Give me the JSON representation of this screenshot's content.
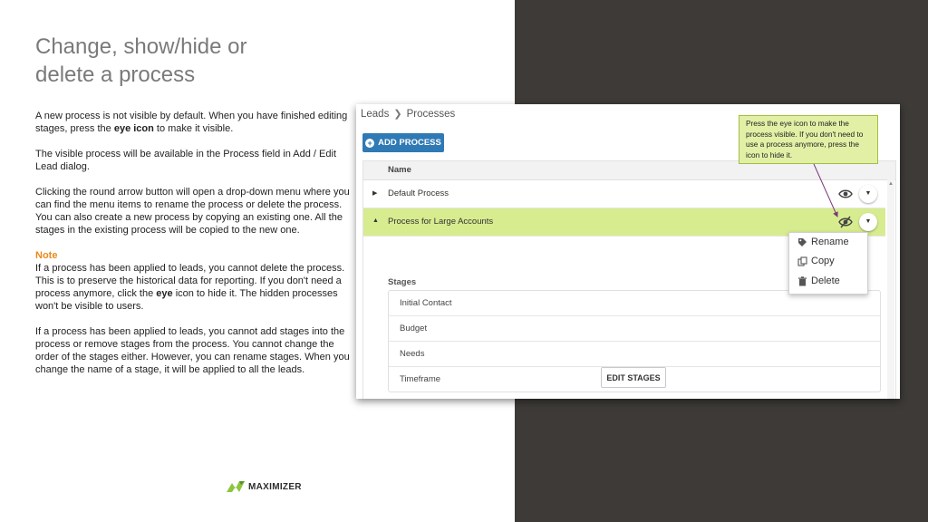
{
  "slide": {
    "title_line1": "Change, show/hide or",
    "title_line2": "delete a process",
    "paragraphs": {
      "p1_a": "A new process is not visible by default. When you have finished editing stages, press the ",
      "p1_b": "eye icon",
      "p1_c": " to make it visible.",
      "p2": "The visible process will be available in the Process field in Add / Edit Lead dialog.",
      "p3": "Clicking the round arrow button will open a drop-down menu where you can find the menu items to rename the process or delete the process. You can also create a new process by copying an existing one. All the stages in the existing process will be copied to the new one.",
      "note_title": "Note",
      "note_a": "If a process has been applied to leads, you cannot delete the process. This is to preserve the historical data for reporting. If you don't need a process anymore, click the ",
      "note_b": "eye",
      "note_c": " icon to hide it. The hidden processes won't be visible to users.",
      "p5": "If a process has been applied to leads, you cannot add stages into the process or remove stages from the process. You cannot change the order of the stages either. However, you can rename stages. When you change the name of a stage, it will be applied to all the leads."
    },
    "logo_text": "MAXIMIZER",
    "colors": {
      "dark_panel": "#3d3a37",
      "accent_orange": "#e98a1b",
      "brand_green": "#8cc63f",
      "selected_row": "#d7ec8f",
      "primary_button": "#2f7ab5"
    }
  },
  "app": {
    "breadcrumb": {
      "root": "Leads",
      "current": "Processes"
    },
    "add_process_label": "ADD PROCESS",
    "table_header": "Name",
    "processes": [
      {
        "name": "Default Process",
        "expanded": false,
        "eye_icon": "eye-icon"
      },
      {
        "name": "Process for Large Accounts",
        "expanded": true,
        "eye_icon": "eye-slash-icon"
      }
    ],
    "stages_label": "Stages",
    "stages": [
      "Initial Contact",
      "Budget",
      "Needs",
      "Timeframe"
    ],
    "edit_stages_label": "EDIT STAGES",
    "dropdown_menu": [
      {
        "label": "Rename",
        "icon": "tag-icon"
      },
      {
        "label": "Copy",
        "icon": "copy-icon"
      },
      {
        "label": "Delete",
        "icon": "trash-icon"
      }
    ],
    "callout_text": "Press the eye icon to make the process visible. If you don't need to use a process anymore, press the icon to hide it."
  }
}
